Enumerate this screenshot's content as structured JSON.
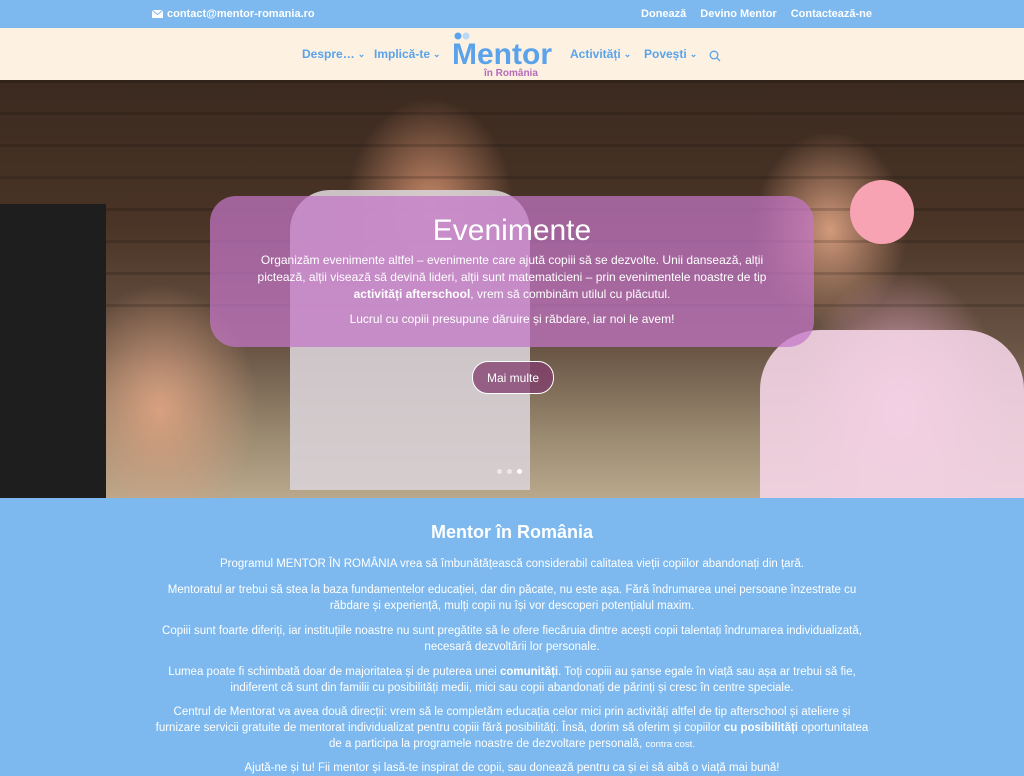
{
  "topbar": {
    "email": "contact@mentor-romania.ro",
    "links": [
      "Donează",
      "Devino Mentor",
      "Contactează-ne"
    ]
  },
  "nav": {
    "items": [
      {
        "label": "Despre…"
      },
      {
        "label": "Implică-te"
      },
      {
        "label": "Activități"
      },
      {
        "label": "Povești"
      }
    ],
    "logo_word": "Mentor",
    "logo_sub": "în România"
  },
  "hero": {
    "title": "Evenimente",
    "p1_before": "Organizăm evenimente altfel – evenimente care ajută copiii să se dezvolte. Unii dansează, alții pictează, alții visează să devină lideri, alții sunt matematicieni – prin evenimentele noastre de tip ",
    "p1_bold": "activități afterschool",
    "p1_after": ", vrem să combinăm utilul cu plăcutul.",
    "p2": "Lucrul cu copiii presupune dăruire și răbdare, iar noi le avem!",
    "button": "Mai multe",
    "slides": 3,
    "active_slide": 3
  },
  "content": {
    "title": "Mentor în România",
    "p1": "Programul MENTOR ÎN ROMÂNIA vrea să îmbunătățească considerabil calitatea vieții copiilor abandonați din țară.",
    "p2": "Mentoratul ar trebui să stea la baza fundamentelor educației, dar din păcate, nu este așa. Fără îndrumarea unei persoane înzestrate cu răbdare și experiență, mulți copii nu își vor descoperi potențialul maxim.",
    "p3": "Copiii sunt foarte diferiți, iar instituțiile noastre nu sunt pregătite să le ofere fiecăruia dintre acești copii talentați îndrumarea individualizată, necesară dezvoltării lor personale.",
    "p4_before": "Lumea poate fi schimbată doar de majoritatea și de puterea unei ",
    "p4_bold": "comunități",
    "p4_after": ". Toți copiii au șanse egale în viață sau așa ar trebui să fie, indiferent că sunt din familii cu posibilități medii, mici sau copii abandonați de părinți și cresc în centre speciale.",
    "p5_before": "Centrul de Mentorat va avea două direcții: vrem să le completăm educația celor mici prin activități altfel de tip afterschool și ateliere și furnizare servicii gratuite de mentorat individualizat pentru copiii fără posibilități. Însă, dorim să oferim și copiilor ",
    "p5_bold": "cu posibilități",
    "p5_after": " oportunitatea de a participa la programele noastre de dezvoltare personală,",
    "p5_small": "contra cost.",
    "p6": "Ajută-ne și tu! Fii mentor și lasă-te inspirat de copii, sau donează pentru ca și ei să aibă o viață mai bună!"
  }
}
